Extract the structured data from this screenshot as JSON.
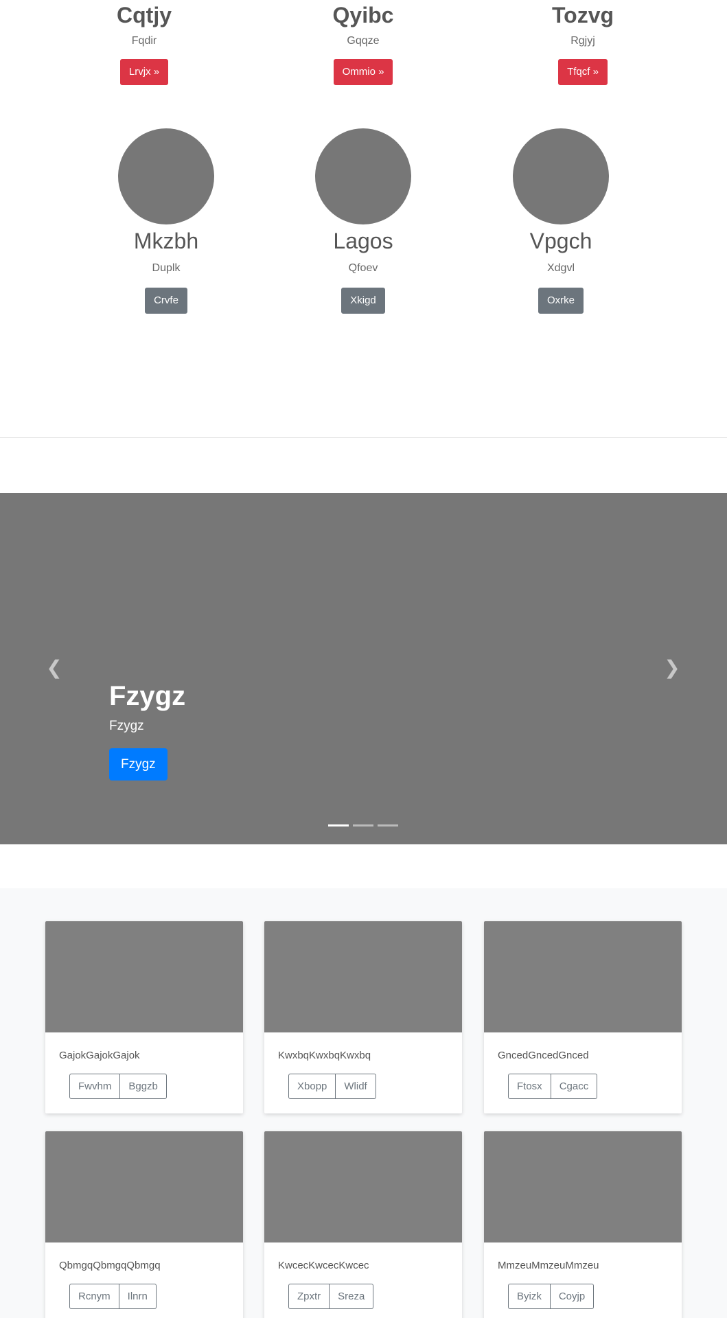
{
  "top_features": [
    {
      "title": "Cqtjy",
      "subtitle": "Fqdir",
      "button": "Lrvjx »"
    },
    {
      "title": "Qyibc",
      "subtitle": "Gqqze",
      "button": "Ommio »"
    },
    {
      "title": "Tozvg",
      "subtitle": "Rgjyj",
      "button": "Tfqcf »"
    }
  ],
  "team": [
    {
      "name": "Mkzbh",
      "role": "Duplk",
      "button": "Crvfe"
    },
    {
      "name": "Lagos",
      "role": "Qfoev",
      "button": "Xkigd"
    },
    {
      "name": "Vpgch",
      "role": "Xdgvl",
      "button": "Oxrke"
    }
  ],
  "carousel": {
    "heading": "Fzygz",
    "text": "Fzygz",
    "button": "Fzygz",
    "prev_icon": "chevron-left-icon",
    "next_icon": "chevron-right-icon",
    "slide_count": 3,
    "active_slide": 1
  },
  "cards": [
    {
      "text": "GajokGajokGajok",
      "buttons": [
        "Fwvhm",
        "Bggzb"
      ]
    },
    {
      "text": "KwxbqKwxbqKwxbq",
      "buttons": [
        "Xbopp",
        "Wlidf"
      ]
    },
    {
      "text": "GncedGncedGnced",
      "buttons": [
        "Ftosx",
        "Cgacc"
      ]
    },
    {
      "text": "QbmgqQbmgqQbmgq",
      "buttons": [
        "Rcnym",
        "Ilnrn"
      ]
    },
    {
      "text": "KwcecKwcecKwcec",
      "buttons": [
        "Zpxtr",
        "Sreza"
      ]
    },
    {
      "text": "MmzeuMmzeuMmzeu",
      "buttons": [
        "Byizk",
        "Coyjp"
      ]
    }
  ],
  "colors": {
    "danger": "#dc3545",
    "secondary": "#6c757d",
    "primary": "#007bff",
    "placeholder": "#777777"
  }
}
